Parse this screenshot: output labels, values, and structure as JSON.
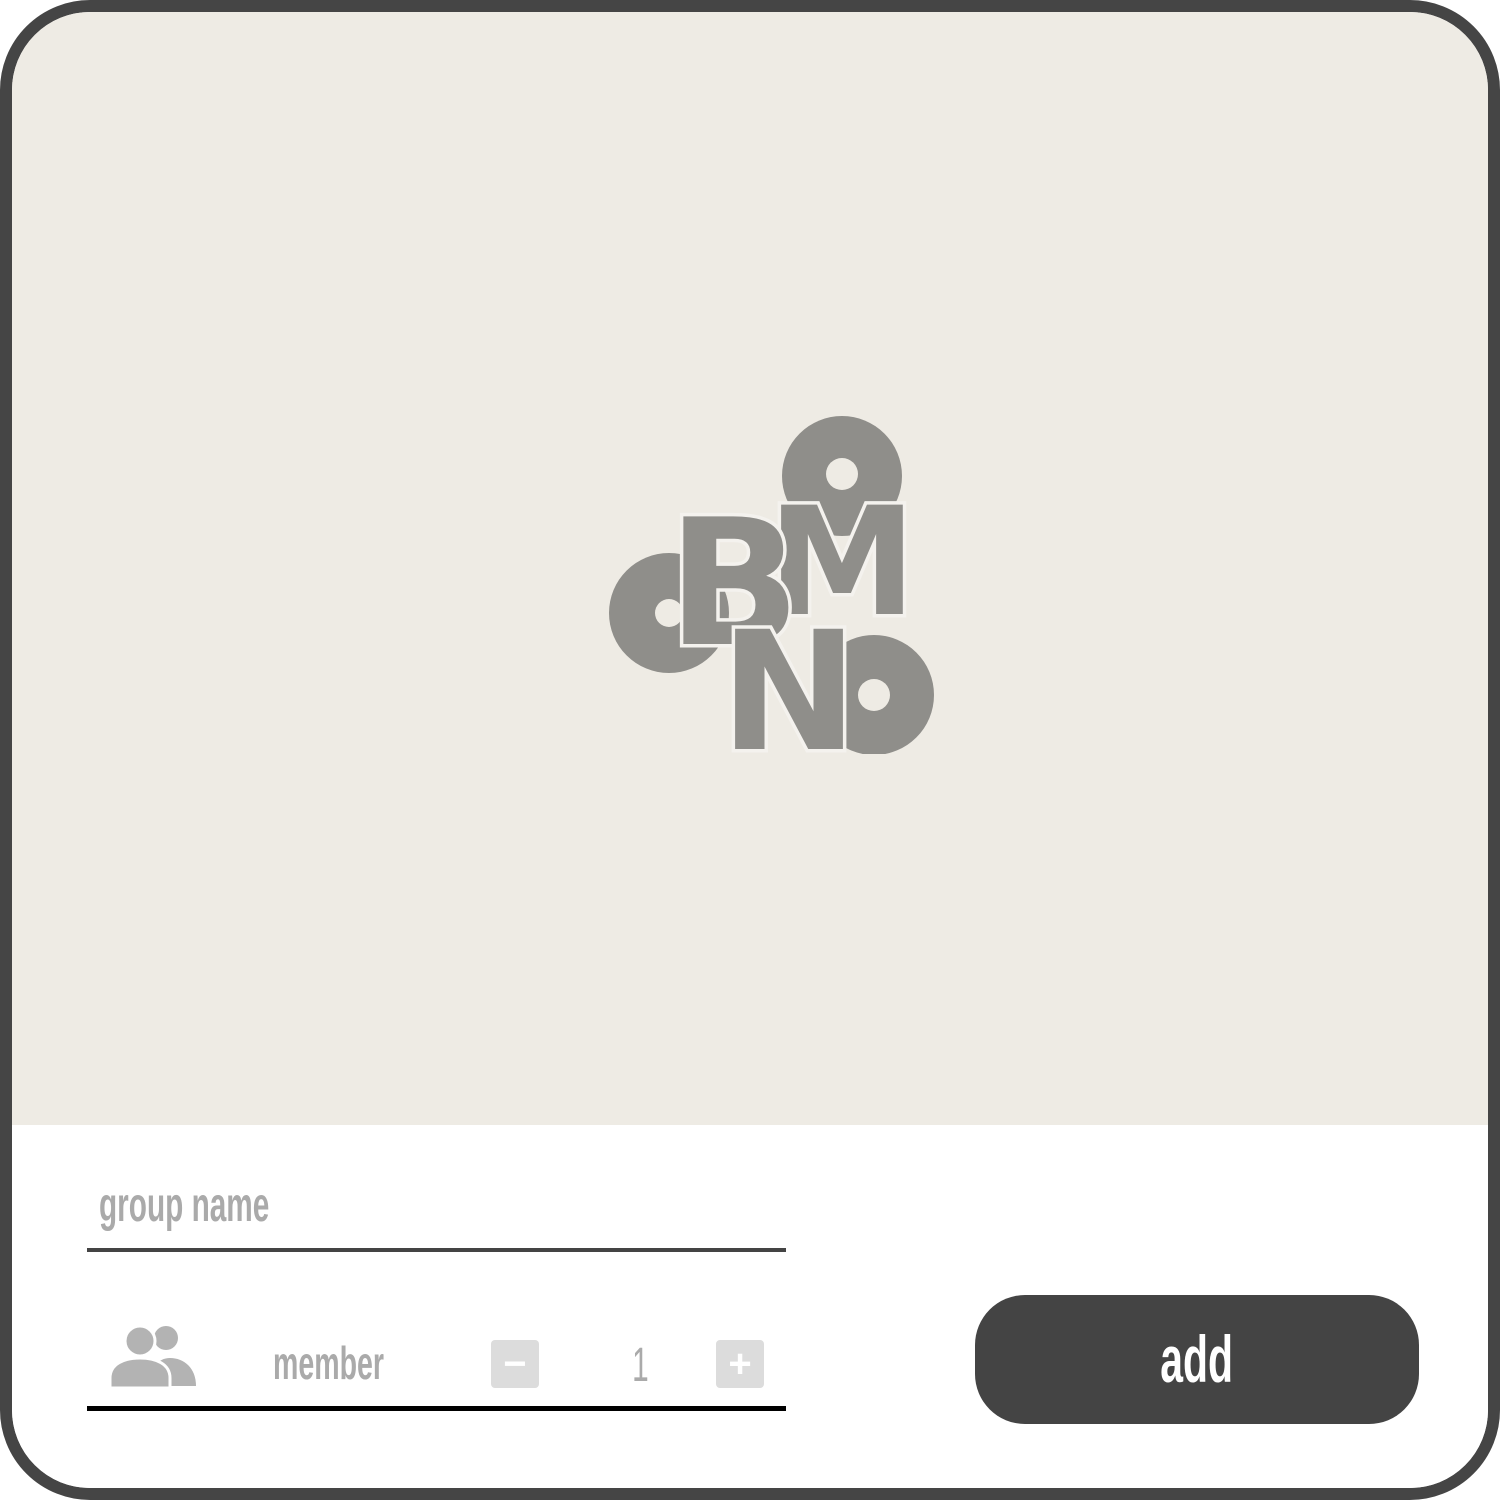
{
  "logo": {
    "letters": [
      "B",
      "M",
      "N"
    ],
    "color": "#8f8e8a",
    "outline": "#f4f2ee"
  },
  "group_name": {
    "placeholder": "group name"
  },
  "member": {
    "label": "member",
    "minus_symbol": "−",
    "value": "1",
    "plus_symbol": "+"
  },
  "actions": {
    "add_label": "add"
  },
  "colors": {
    "hero_bg": "#eeebe4",
    "frame": "#454545",
    "button": "#444444",
    "muted_text": "#aaaaaa"
  }
}
